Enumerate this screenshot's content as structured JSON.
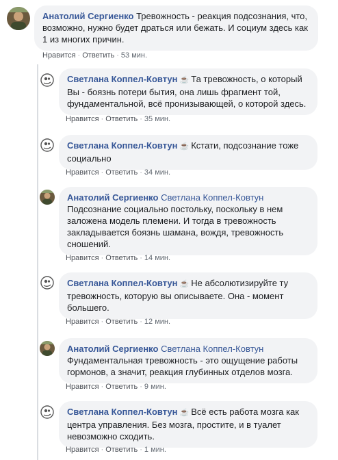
{
  "colors": {
    "author": "#385898",
    "bubble": "#f2f3f5",
    "meta": "#606770",
    "thread_line": "#dadde1"
  },
  "cup_icon": "coffee-cup-icon",
  "comments": [
    {
      "author": "Анатолий Сергиенко",
      "mention": "",
      "text": "Тревожность - реакция подсознания, что, возможно, нужно будет драться или бежать. И социум здесь как 1 из многих причин.",
      "like": "Нравится",
      "reply": "Ответить",
      "time": "53 мин."
    },
    {
      "author": "Светлана Коппел-Ковтун",
      "mention": "",
      "text": "Та тревожность, о который Вы - боязнь потери бытия, она лишь фрагмент той, фундаментальной, всё пронизывающей, о которой здесь.",
      "like": "Нравится",
      "reply": "Ответить",
      "time": "35 мин."
    },
    {
      "author": "Светлана Коппел-Ковтун",
      "mention": "",
      "text": "Кстати, подсознание тоже социально",
      "like": "Нравится",
      "reply": "Ответить",
      "time": "34 мин."
    },
    {
      "author": "Анатолий Сергиенко",
      "mention": "Светлана Коппел-Ковтун",
      "text": "Подсознание социально постольку, поскольку в нем заложена модель племени. И тогда в тревожность закладывается боязнь шамана, вождя, тревожность сношений.",
      "like": "Нравится",
      "reply": "Ответить",
      "time": "14 мин."
    },
    {
      "author": "Светлана Коппел-Ковтун",
      "mention": "",
      "text": "Не абсолютизируйте ту тревожность, которую вы описываете. Она - момент большего.",
      "like": "Нравится",
      "reply": "Ответить",
      "time": "12 мин."
    },
    {
      "author": "Анатолий Сергиенко",
      "mention": "Светлана Коппел-Ковтун",
      "text": "Фундаментальная тревожность - это ощущение работы гормонов, а значит, реакция глубинных отделов мозга.",
      "like": "Нравится",
      "reply": "Ответить",
      "time": "9 мин."
    },
    {
      "author": "Светлана Коппел-Ковтун",
      "mention": "",
      "text": "Всё есть работа мозга как центра управления. Без мозга, простите, и в туалет невозможно сходить.",
      "like": "Нравится",
      "reply": "Ответить",
      "time": "1 мин."
    }
  ]
}
